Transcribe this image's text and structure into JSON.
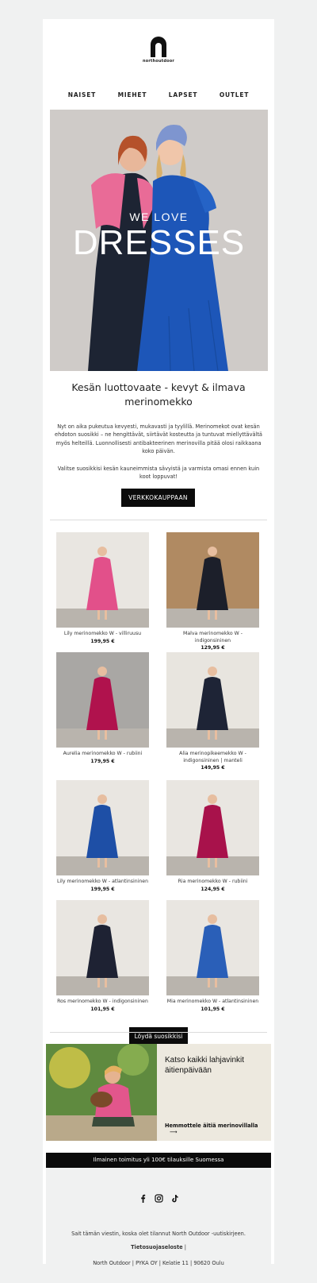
{
  "brand": {
    "logo_text": "northoutdoor"
  },
  "nav": {
    "items": [
      "NAISET",
      "MIEHET",
      "LAPSET",
      "OUTLET"
    ]
  },
  "hero": {
    "line1": "WE LOVE",
    "line2": "DRESSES"
  },
  "intro": {
    "headline": "Kesän luottovaate - kevyt & ilmava merinomekko",
    "paragraph1": "Nyt on aika pukeutua kevyesti, mukavasti ja tyylillä. Merinomekot ovat kesän ehdoton suosikki – ne hengittävät, siirtävät kosteutta ja tuntuvat miellyttävältä myös helteillä. Luonnollisesti antibakteerinen merinovilla pitää olosi raikkaana koko päivän.",
    "paragraph2": "Valitse suosikkisi kesän kauneimmista sävyistä ja varmista omasi ennen kuin koot loppuvat!",
    "button": "VERKKOKAUPPAAN"
  },
  "products": [
    {
      "name": "Lily merinomekko W - villiruusu",
      "price": "199,95 €",
      "dress": "#e2508a",
      "bg": "#e9e6e1"
    },
    {
      "name": "Malva merinomekko W - indigonsininen",
      "price": "129,95 €",
      "dress": "#1c1f2a",
      "bg": "#b08a62"
    },
    {
      "name": "Aurelia merinomekko W - rubiini",
      "price": "179,95 €",
      "dress": "#b0124d",
      "bg": "#a9a7a4"
    },
    {
      "name": "Alia merinopikeemekko W - indigonsininen | manteli",
      "price": "149,95 €",
      "dress": "#1e2436",
      "bg": "#e8e5df"
    },
    {
      "name": "Lily merinomekko W - atlantinsininen",
      "price": "199,95 €",
      "dress": "#1e4fa6",
      "bg": "#e9e6e1"
    },
    {
      "name": "Ria merinomekko W - rubiini",
      "price": "124,95 €",
      "dress": "#a8124b",
      "bg": "#e9e6e1"
    },
    {
      "name": "Ros merinomekko W - indigonsininen",
      "price": "101,95 €",
      "dress": "#1e2233",
      "bg": "#e9e6e1"
    },
    {
      "name": "Mia merinomekko W - atlantinsininen",
      "price": "101,95 €",
      "dress": "#2a5fb8",
      "bg": "#e9e6e1"
    }
  ],
  "favorites_button": "Löydä suosikkisi",
  "promo": {
    "title": "Katso kaikki lahjavinkit äitienpäivään",
    "link": "Hemmottele äitiä merinovillalla",
    "arrow": "⟶"
  },
  "shipping": "Ilmainen toimitus yli 100€ tilauksille Suomessa",
  "footer": {
    "social": [
      "facebook-icon",
      "instagram-icon",
      "tiktok-icon"
    ],
    "notice": "Sait tämän viestin, koska olet tilannut North Outdoor -uutiskirjeen.",
    "privacy": "Tietosuojaseloste",
    "separator": "|",
    "address": "North Outdoor | PYKA OY | Kelatie 11 | 90620 Oulu"
  },
  "colors": {
    "black": "#0b0b0b",
    "background": "#f0f1f1",
    "promo_bg": "#ede9df"
  }
}
